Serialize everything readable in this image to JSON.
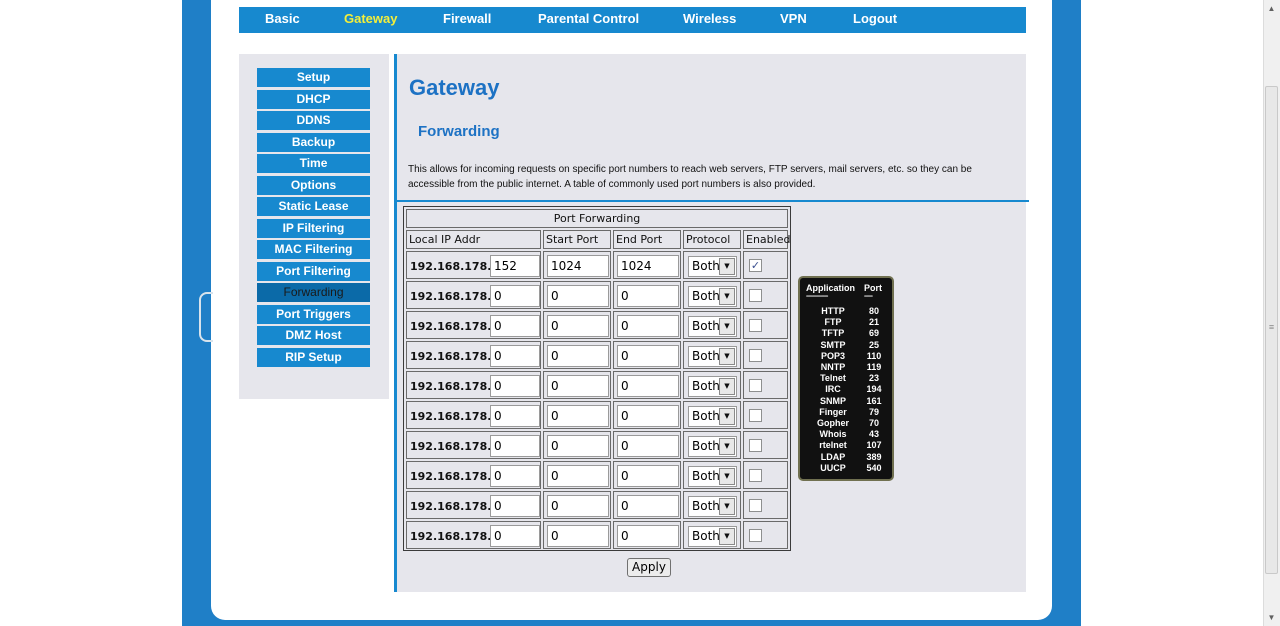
{
  "nav": {
    "items": [
      "Basic",
      "Gateway",
      "Firewall",
      "Parental Control",
      "Wireless",
      "VPN",
      "Logout"
    ],
    "active": "Gateway"
  },
  "sidebar": {
    "items": [
      "Setup",
      "DHCP",
      "DDNS",
      "Backup",
      "Time",
      "Options",
      "Static Lease",
      "IP Filtering",
      "MAC Filtering",
      "Port Filtering",
      "Forwarding",
      "Port Triggers",
      "DMZ Host",
      "RIP Setup"
    ],
    "active": "Forwarding"
  },
  "content": {
    "title": "Gateway",
    "section": "Forwarding",
    "description": "This allows for incoming requests on specific port numbers to reach web servers, FTP servers, mail servers, etc. so they can be accessible from the public internet. A table of commonly used port numbers is also provided."
  },
  "table": {
    "caption": "Port Forwarding",
    "headers": [
      "Local IP Addr",
      "Start Port",
      "End Port",
      "Protocol",
      "Enabled"
    ],
    "ip_prefix": "192.168.178.",
    "rows": [
      {
        "ip": "152",
        "start": "1024",
        "end": "1024",
        "protocol": "Both",
        "enabled": true
      },
      {
        "ip": "0",
        "start": "0",
        "end": "0",
        "protocol": "Both",
        "enabled": false
      },
      {
        "ip": "0",
        "start": "0",
        "end": "0",
        "protocol": "Both",
        "enabled": false
      },
      {
        "ip": "0",
        "start": "0",
        "end": "0",
        "protocol": "Both",
        "enabled": false
      },
      {
        "ip": "0",
        "start": "0",
        "end": "0",
        "protocol": "Both",
        "enabled": false
      },
      {
        "ip": "0",
        "start": "0",
        "end": "0",
        "protocol": "Both",
        "enabled": false
      },
      {
        "ip": "0",
        "start": "0",
        "end": "0",
        "protocol": "Both",
        "enabled": false
      },
      {
        "ip": "0",
        "start": "0",
        "end": "0",
        "protocol": "Both",
        "enabled": false
      },
      {
        "ip": "0",
        "start": "0",
        "end": "0",
        "protocol": "Both",
        "enabled": false
      },
      {
        "ip": "0",
        "start": "0",
        "end": "0",
        "protocol": "Both",
        "enabled": false
      }
    ]
  },
  "apply_label": "Apply",
  "ports_ref": {
    "headers": [
      "Application",
      "Port"
    ],
    "dash_app": "----------------",
    "dash_port": "------",
    "entries": [
      [
        "HTTP",
        "80"
      ],
      [
        "FTP",
        "21"
      ],
      [
        "TFTP",
        "69"
      ],
      [
        "SMTP",
        "25"
      ],
      [
        "POP3",
        "110"
      ],
      [
        "NNTP",
        "119"
      ],
      [
        "Telnet",
        "23"
      ],
      [
        "IRC",
        "194"
      ],
      [
        "SNMP",
        "161"
      ],
      [
        "Finger",
        "79"
      ],
      [
        "Gopher",
        "70"
      ],
      [
        "Whois",
        "43"
      ],
      [
        "rtelnet",
        "107"
      ],
      [
        "LDAP",
        "389"
      ],
      [
        "UUCP",
        "540"
      ]
    ]
  },
  "colors": {
    "accent": "#1789cf",
    "active_nav": "#f4ef3a",
    "title": "#1d72c4",
    "panel_bg": "#e6e6ec"
  },
  "icons": {
    "scroll_up": "▲",
    "scroll_down": "▼",
    "scroll_grip": "≡",
    "select_arrow": "▼",
    "check": "✓"
  }
}
